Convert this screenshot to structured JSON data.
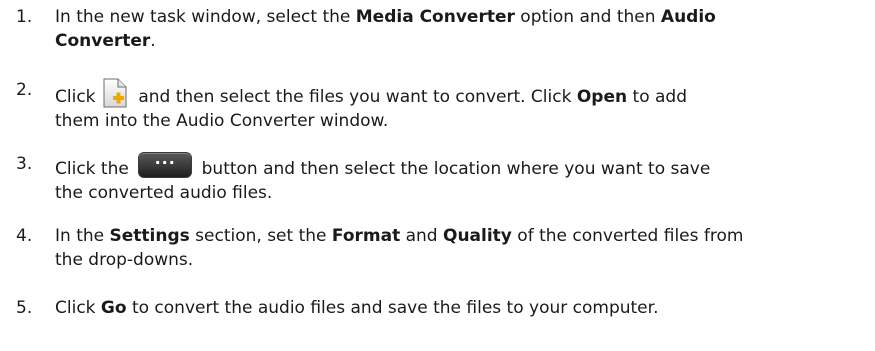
{
  "steps": [
    {
      "number": "1.",
      "line1": {
        "t1": "In the new task window, select the ",
        "b1": "Media Converter",
        "t2": " option and then ",
        "b2": "Audio"
      },
      "line2": {
        "b1": "Converter",
        "t1": "."
      }
    },
    {
      "number": "2.",
      "icon": "add-file-icon",
      "line1": {
        "t0": "Click ",
        "t1": " and then select the files you want to convert. Click ",
        "b1": "Open",
        "t2": " to add"
      },
      "line2": {
        "t1": "them into the Audio Converter window."
      }
    },
    {
      "number": "3.",
      "icon": "browse-ellipsis-button",
      "line1": {
        "t0": "Click the ",
        "dots": "···",
        "t1": " button and then select the location where you want to save"
      },
      "line2": {
        "t1": "the converted audio files."
      }
    },
    {
      "number": "4.",
      "line1": {
        "t1": "In the ",
        "b1": "Settings",
        "t2": " section, set the ",
        "b2": "Format",
        "t3": " and ",
        "b3": "Quality",
        "t4": " of the converted files from"
      },
      "line2": {
        "t1": "the drop-downs."
      }
    },
    {
      "number": "5.",
      "line1": {
        "t1": "Click ",
        "b1": "Go",
        "t2": " to convert the audio files and save the files to your computer."
      }
    }
  ],
  "colors": {
    "text": "#1a1a1a",
    "button_dark": "#1e1e1e",
    "file_icon_plus": "#f0a800"
  }
}
